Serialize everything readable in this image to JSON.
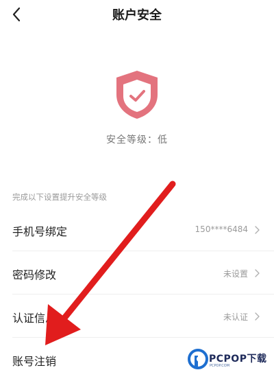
{
  "header": {
    "title": "账户安全",
    "back_icon": "chevron-left-icon"
  },
  "security": {
    "level_label": "安全等级：",
    "level_value": "低",
    "shield_icon": "shield-check-icon",
    "shield_color": "#e3737e"
  },
  "section": {
    "title": "完成以下设置提升安全等级"
  },
  "items": [
    {
      "label": "手机号绑定",
      "value": "150****6484"
    },
    {
      "label": "密码修改",
      "value": "未设置"
    },
    {
      "label": "认证信息",
      "value": "未认证"
    },
    {
      "label": "账号注销",
      "value": ""
    }
  ],
  "overlay": {
    "arrow_color": "#e11d1d",
    "watermark_text": "PCPOP下载",
    "watermark_sub": "PCPOP.COM"
  }
}
